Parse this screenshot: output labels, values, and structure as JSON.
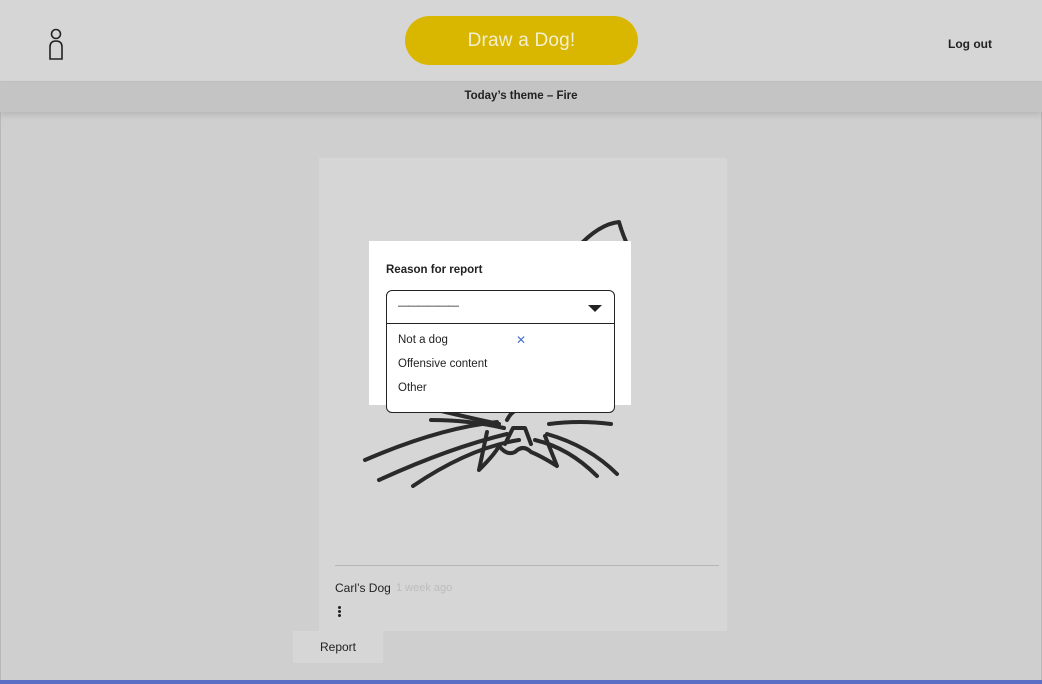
{
  "header": {
    "logo_icon": "person-outline-icon",
    "cta_label": "Draw a Dog!",
    "logout_label": "Log out"
  },
  "theme_bar": {
    "text": "Today’s theme – Fire"
  },
  "card": {
    "drawing_icon": "cat-line-drawing",
    "dog_name": "Carl’s Dog",
    "timestamp": "1 week ago",
    "menu_icon": "kebab-menu-icon"
  },
  "report_button": {
    "label": "Report"
  },
  "modal": {
    "title": "Reason for report",
    "select": {
      "value": "——————",
      "caret_icon": "caret-down-icon",
      "options": [
        "Not a dog",
        "Offensive content",
        "Other"
      ],
      "clear_icon": "close-icon"
    }
  },
  "colors": {
    "accent": "#d9b700",
    "background": "#cfcfcf",
    "link_blue": "#5b6fc4"
  }
}
